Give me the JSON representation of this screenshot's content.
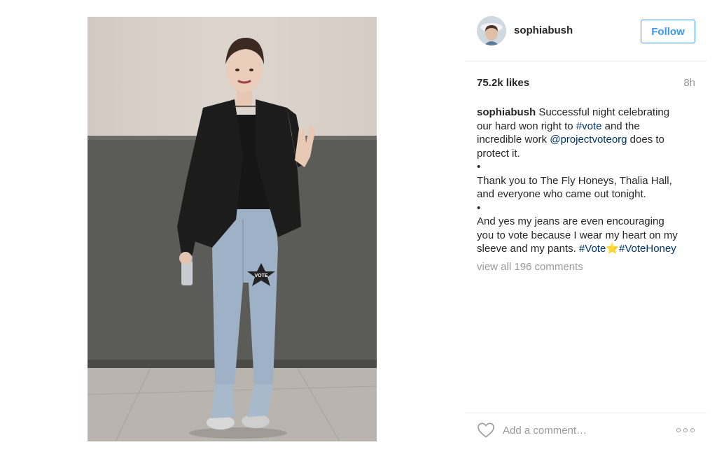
{
  "post": {
    "username": "sophiabush",
    "follow_label": "Follow",
    "likes": "75.2k likes",
    "time_ago": "8h",
    "caption": {
      "username": "sophiabush",
      "line1_rest": " Successful night celebrating",
      "line2_a": "our hard won right to ",
      "line2_tag": "#vote",
      "line2_b": " and the",
      "line3": "incredible work ",
      "line3_mention": "@projectvoteorg",
      "line3_b": " does to",
      "line4": "protect it.",
      "bullet1": "•",
      "line5": "Thank you to The Fly Honeys, Thalia Hall,",
      "line6": "and everyone who came out tonight.",
      "bullet2": "•",
      "line7": "And yes my jeans are even encouraging",
      "line8": "you to vote because I wear my heart on my",
      "line9_a": "sleeve and my pants. ",
      "line9_tag1": "#Vote",
      "line9_star": "⭐",
      "line9_tag2": "#VoteHoney"
    },
    "view_comments": "view all 196 comments",
    "comment_placeholder": "Add a comment…",
    "photo_patch_text": "VOTE"
  },
  "colors": {
    "accent": "#3897f0",
    "link": "#003569",
    "muted": "#999999",
    "text": "#262626"
  },
  "icons": {
    "heart": "heart-outline-icon",
    "more": "more-options-icon"
  }
}
